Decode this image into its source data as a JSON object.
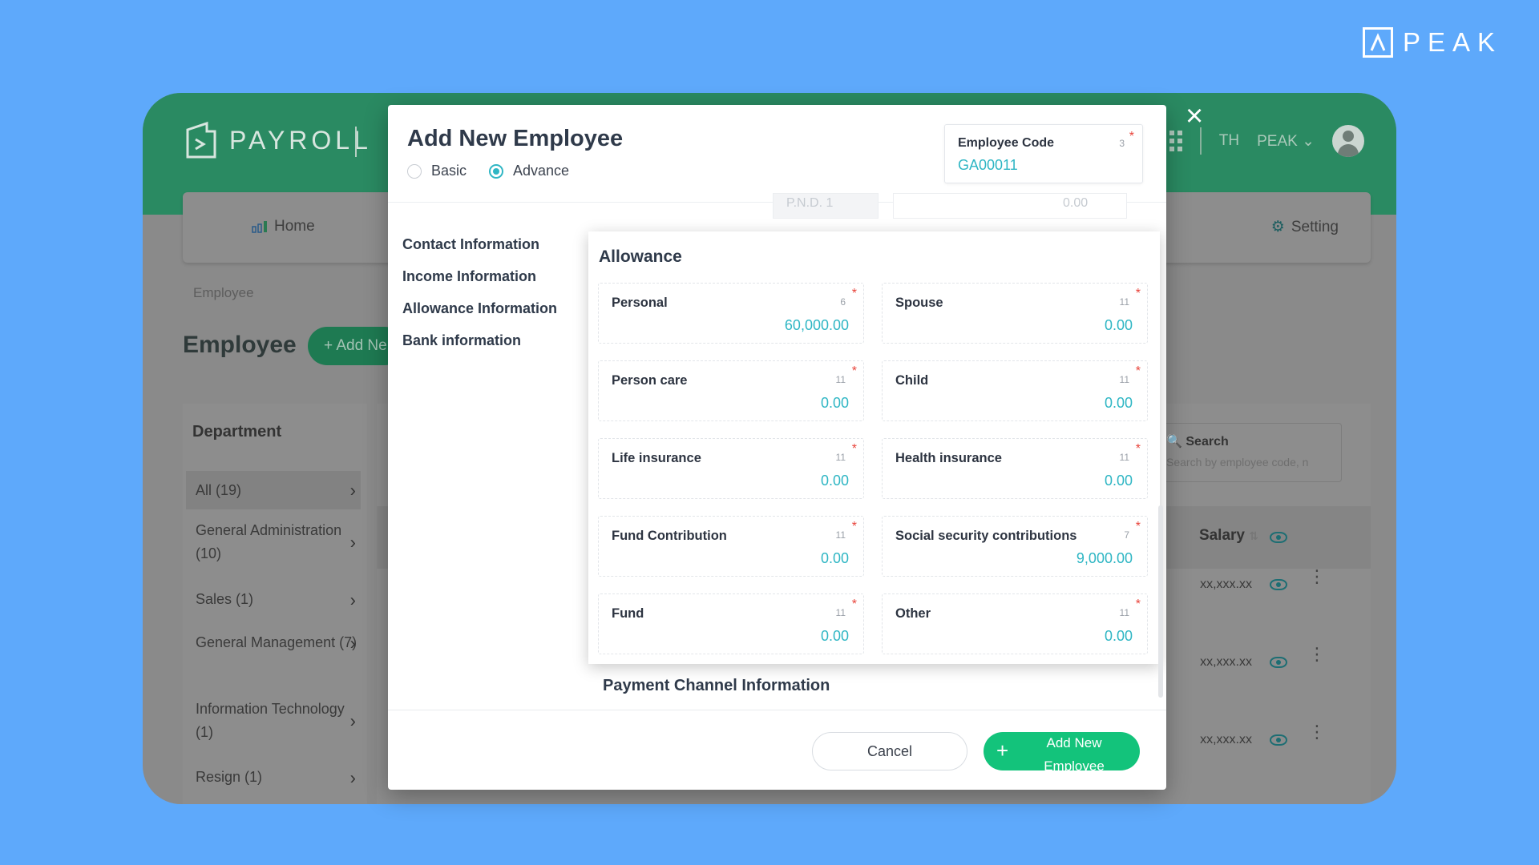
{
  "brand": {
    "peak_logo": "PEAK",
    "payroll_logo": "PAYROLL"
  },
  "header": {
    "language": "TH",
    "user": "PEAK"
  },
  "nav": {
    "home": "Home",
    "setting": "Setting"
  },
  "breadcrumb": "Employee",
  "page_title": "Employee",
  "add_button": "+ Add Ne",
  "department": {
    "title": "Department",
    "items": [
      {
        "label": "All (19)"
      },
      {
        "label": "General Administration (10)"
      },
      {
        "label": "Sales (1)"
      },
      {
        "label": "General Management (7)"
      },
      {
        "label": "Information Technology (1)"
      },
      {
        "label": "Resign (1)"
      }
    ]
  },
  "list": {
    "search_label": "Search",
    "search_placeholder": "Search by employee code, n",
    "salary_header": "Salary",
    "rows": [
      {
        "salary": "xx,xxx.xx"
      },
      {
        "salary": "xx,xxx.xx"
      },
      {
        "salary": "xx,xxx.xx"
      }
    ]
  },
  "modal": {
    "title": "Add New Employee",
    "modes": {
      "basic": "Basic",
      "advance": "Advance",
      "selected": "Advance"
    },
    "employee_code": {
      "label": "Employee Code",
      "value": "GA00011",
      "count": "3",
      "required": "*"
    },
    "sidenav": [
      "Contact Information",
      "Income Information",
      "Allowance Information",
      "Bank information"
    ],
    "behind": {
      "pnd": "P.N.D. 1",
      "amount": "0.00"
    },
    "allowance": {
      "title": "Allowance",
      "fields": [
        {
          "name": "Personal",
          "count": "6",
          "value": "60,000.00",
          "required": "*"
        },
        {
          "name": "Spouse",
          "count": "11",
          "value": "0.00",
          "required": "*"
        },
        {
          "name": "Person care",
          "count": "11",
          "value": "0.00",
          "required": "*"
        },
        {
          "name": "Child",
          "count": "11",
          "value": "0.00",
          "required": "*"
        },
        {
          "name": "Life insurance",
          "count": "11",
          "value": "0.00",
          "required": "*"
        },
        {
          "name": "Health insurance",
          "count": "11",
          "value": "0.00",
          "required": "*"
        },
        {
          "name": "Fund Contribution",
          "count": "11",
          "value": "0.00",
          "required": "*"
        },
        {
          "name": "Social security contributions",
          "count": "7",
          "value": "9,000.00",
          "required": "*"
        },
        {
          "name": "Fund",
          "count": "11",
          "value": "0.00",
          "required": "*"
        },
        {
          "name": "Other",
          "count": "11",
          "value": "0.00",
          "required": "*"
        }
      ]
    },
    "payment_title": "Payment Channel Information",
    "cancel_label": "Cancel",
    "add_label": "Add New Employee",
    "add_plus": "+"
  },
  "colors": {
    "background": "#5ea9fb",
    "accent_teal": "#2fb6c4",
    "primary_green": "#13c37b",
    "header_green": "#2a8a62",
    "required_red": "#e8433a"
  }
}
